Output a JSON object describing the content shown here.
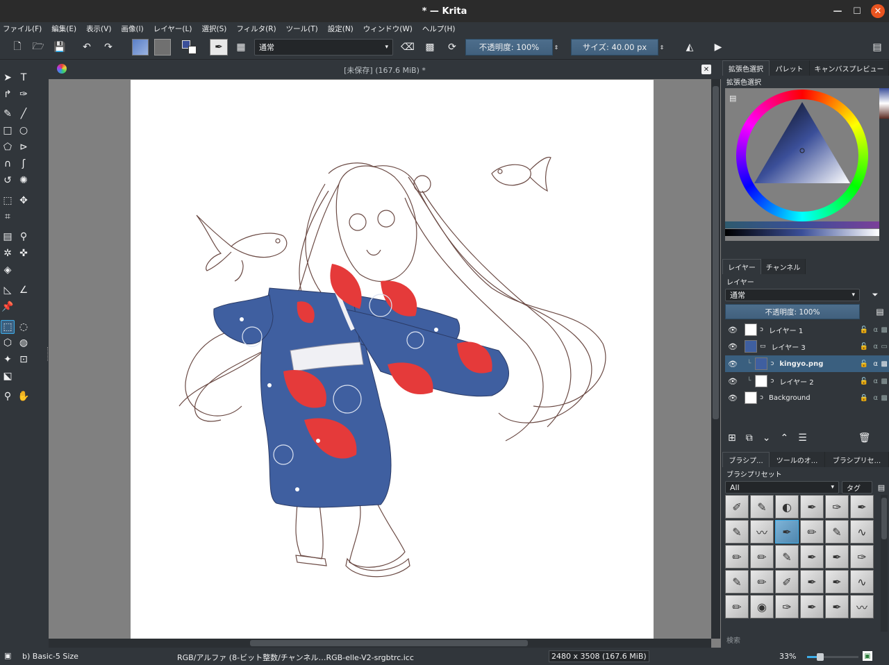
{
  "window": {
    "title": "* — Krita"
  },
  "menu": [
    "ファイル(F)",
    "編集(E)",
    "表示(V)",
    "画像(I)",
    "レイヤー(L)",
    "選択(S)",
    "フィルタ(R)",
    "ツール(T)",
    "設定(N)",
    "ウィンドウ(W)",
    "ヘルプ(H)"
  ],
  "toolbar": {
    "blend_mode": "通常",
    "opacity": "不透明度: 100%",
    "size": "サイズ: 40.00 px"
  },
  "document": {
    "tab_title": "[未保存]  (167.6 MiB) *"
  },
  "docker_top": {
    "tabs": [
      "拡張色選択",
      "パレット",
      "キャンバスプレビュー"
    ],
    "title": "拡張色選択"
  },
  "layers_panel": {
    "tabs": [
      "レイヤー",
      "チャンネル"
    ],
    "title": "レイヤー",
    "blend_mode": "通常",
    "opacity": "不透明度: 100%",
    "layers": [
      {
        "name": "レイヤー 1"
      },
      {
        "name": "レイヤー 3"
      },
      {
        "name": "kingyo.png"
      },
      {
        "name": "レイヤー 2"
      },
      {
        "name": "Background"
      }
    ]
  },
  "brush_panel": {
    "tabs": [
      "ブラシプ...",
      "ツールのオ...",
      "ブラシプリセ..."
    ],
    "title": "ブラシプリセット",
    "filter": "All",
    "tag": "タグ",
    "search_placeholder": "検索"
  },
  "status": {
    "brush": "b) Basic-5 Size",
    "color_space": "RGB/アルファ (8-ビット整数/チャンネル…RGB-elle-V2-srgbtrc.icc",
    "dimensions": "2480 x 3508 (167.6 MiB)",
    "zoom": "33%"
  },
  "colors": {
    "accent": "#3daee9",
    "kimono_blue": "#3f5fa0",
    "goldfish_red": "#e53a3a",
    "line": "#6b4a44",
    "fg_color": "#3b4f99",
    "bg_color": "#ffffff"
  }
}
